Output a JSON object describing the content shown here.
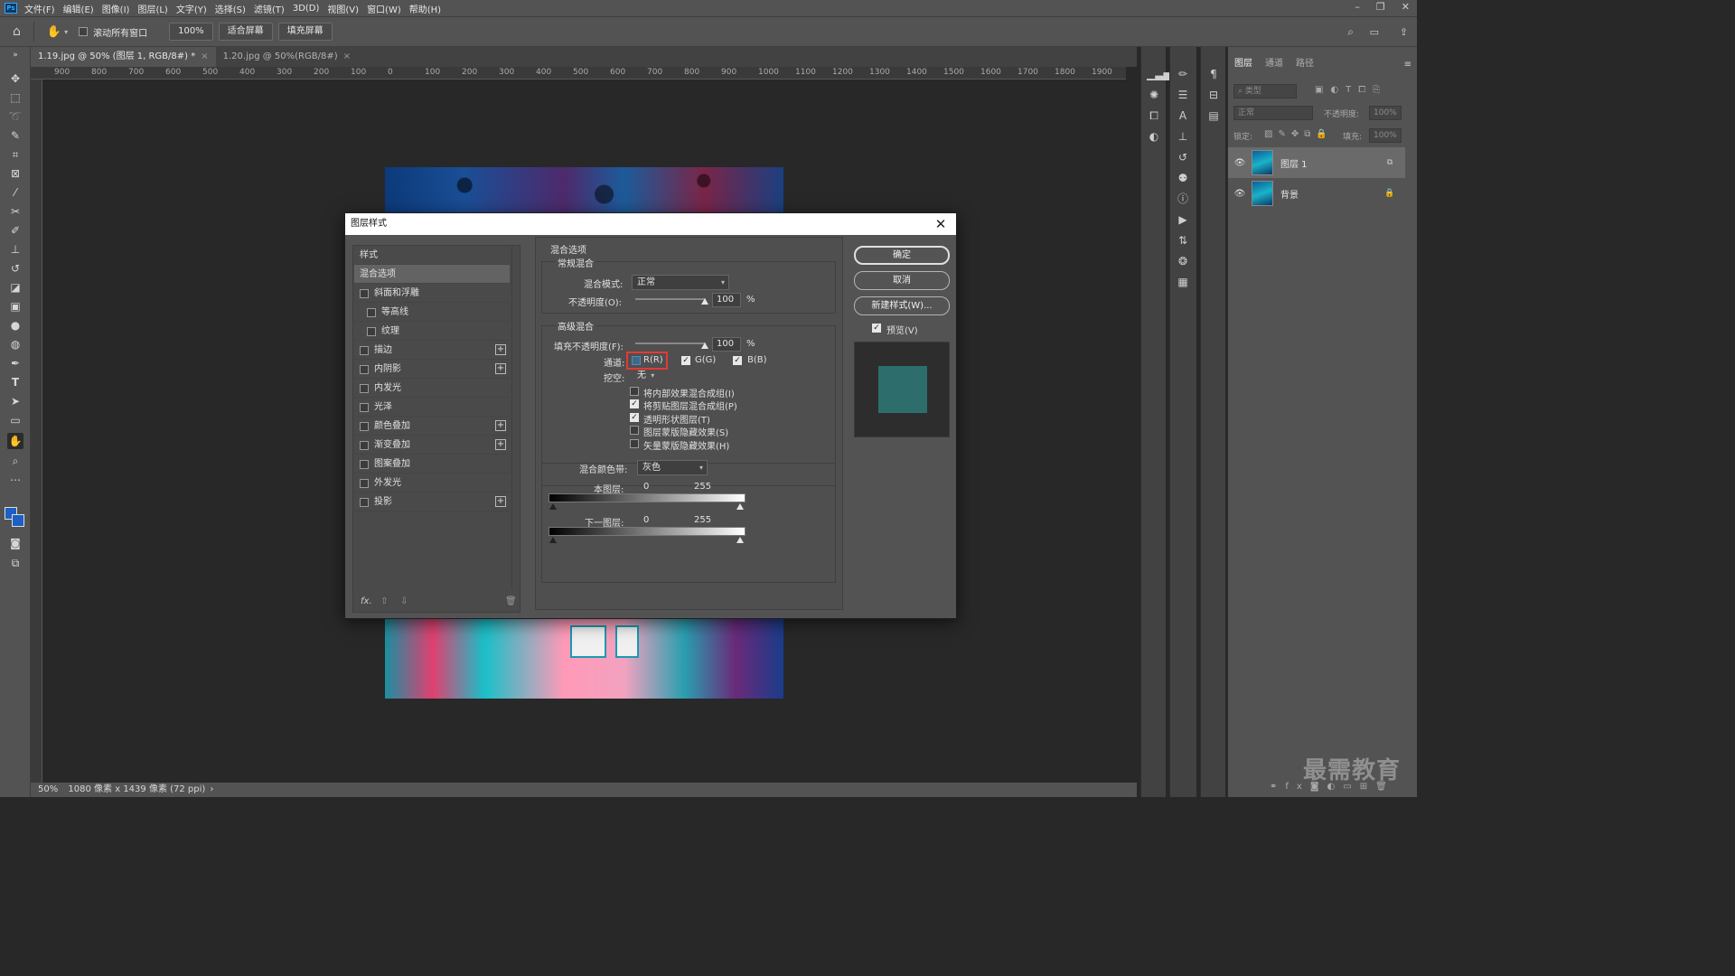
{
  "app": {
    "logo": "Ps",
    "menu": [
      "文件(F)",
      "编辑(E)",
      "图像(I)",
      "图层(L)",
      "文字(Y)",
      "选择(S)",
      "滤镜(T)",
      "3D(D)",
      "视图(V)",
      "窗口(W)",
      "帮助(H)"
    ],
    "window_controls": [
      "–",
      "❐",
      "✕"
    ]
  },
  "options_bar": {
    "scroll_all_label": "滚动所有窗口",
    "zoom_value": "100%",
    "fit_screen": "适合屏幕",
    "fill_screen": "填充屏幕"
  },
  "tabs": [
    {
      "label": "1.19.jpg @ 50% (图层 1, RGB/8#) *",
      "close": "×"
    },
    {
      "label": "1.20.jpg @ 50%(RGB/8#)",
      "close": "×"
    }
  ],
  "ruler_h": [
    "900",
    "800",
    "700",
    "600",
    "500",
    "400",
    "300",
    "200",
    "100",
    "0",
    "100",
    "200",
    "300",
    "400",
    "500",
    "600",
    "700",
    "800",
    "900",
    "1000",
    "1100",
    "1200",
    "1300",
    "1400",
    "1500",
    "1600",
    "1700",
    "1800",
    "1900"
  ],
  "status": {
    "zoom": "50%",
    "info": "1080 像素 x 1439 像素 (72 ppi)",
    "arrow": "›"
  },
  "layers_panel": {
    "tabs": [
      "图层",
      "通道",
      "路径"
    ],
    "filter_placeholder": "类型",
    "blend_mode": "正常",
    "opacity_label": "不透明度:",
    "opacity_value": "100%",
    "lock_label": "锁定:",
    "fill_label": "填充:",
    "fill_value": "100%",
    "layers": [
      {
        "name": "图层 1",
        "selected": true
      },
      {
        "name": "背景",
        "selected": false
      }
    ]
  },
  "dialog": {
    "title": "图层样式",
    "style_list": [
      {
        "label": "样式",
        "type": "header"
      },
      {
        "label": "混合选项",
        "type": "active"
      },
      {
        "label": "斜面和浮雕",
        "type": "check",
        "plus": false
      },
      {
        "label": "等高线",
        "type": "sub",
        "plus": false
      },
      {
        "label": "纹理",
        "type": "sub",
        "plus": false
      },
      {
        "label": "描边",
        "type": "check",
        "plus": true
      },
      {
        "label": "内阴影",
        "type": "check",
        "plus": true
      },
      {
        "label": "内发光",
        "type": "check",
        "plus": false
      },
      {
        "label": "光泽",
        "type": "check",
        "plus": false
      },
      {
        "label": "颜色叠加",
        "type": "check",
        "plus": true
      },
      {
        "label": "渐变叠加",
        "type": "check",
        "plus": true
      },
      {
        "label": "图案叠加",
        "type": "check",
        "plus": false
      },
      {
        "label": "外发光",
        "type": "check",
        "plus": false
      },
      {
        "label": "投影",
        "type": "check",
        "plus": true
      }
    ],
    "fx_label": "fx.",
    "blending_options_title": "混合选项",
    "general_blending": {
      "title": "常规混合",
      "mode_label": "混合模式:",
      "mode_value": "正常",
      "opacity_label": "不透明度(O):",
      "opacity_value": "100",
      "percent": "%"
    },
    "advanced_blending": {
      "title": "高级混合",
      "fill_opacity_label": "填充不透明度(F):",
      "fill_opacity_value": "100",
      "percent": "%",
      "channels_label": "通道:",
      "channel_r": "R(R)",
      "channel_g": "G(G)",
      "channel_b": "B(B)",
      "knockout_label": "挖空:",
      "knockout_value": "无",
      "options": [
        {
          "label": "将内部效果混合成组(I)",
          "checked": false
        },
        {
          "label": "将剪贴图层混合成组(P)",
          "checked": true
        },
        {
          "label": "透明形状图层(T)",
          "checked": true
        },
        {
          "label": "图层蒙版隐藏效果(S)",
          "checked": false
        },
        {
          "label": "矢量蒙版隐藏效果(H)",
          "checked": false
        }
      ]
    },
    "blend_if": {
      "label": "混合颜色带:",
      "value": "灰色",
      "this_layer_label": "本图层:",
      "this_layer_low": "0",
      "this_layer_high": "255",
      "under_layer_label": "下一图层:",
      "under_layer_low": "0",
      "under_layer_high": "255"
    },
    "buttons": {
      "ok": "确定",
      "cancel": "取消",
      "new_style": "新建样式(W)...",
      "preview": "预览(V)"
    },
    "highlight_color": "#e53935",
    "preview_color": "#2d6e6d"
  },
  "watermark": "最需教育"
}
